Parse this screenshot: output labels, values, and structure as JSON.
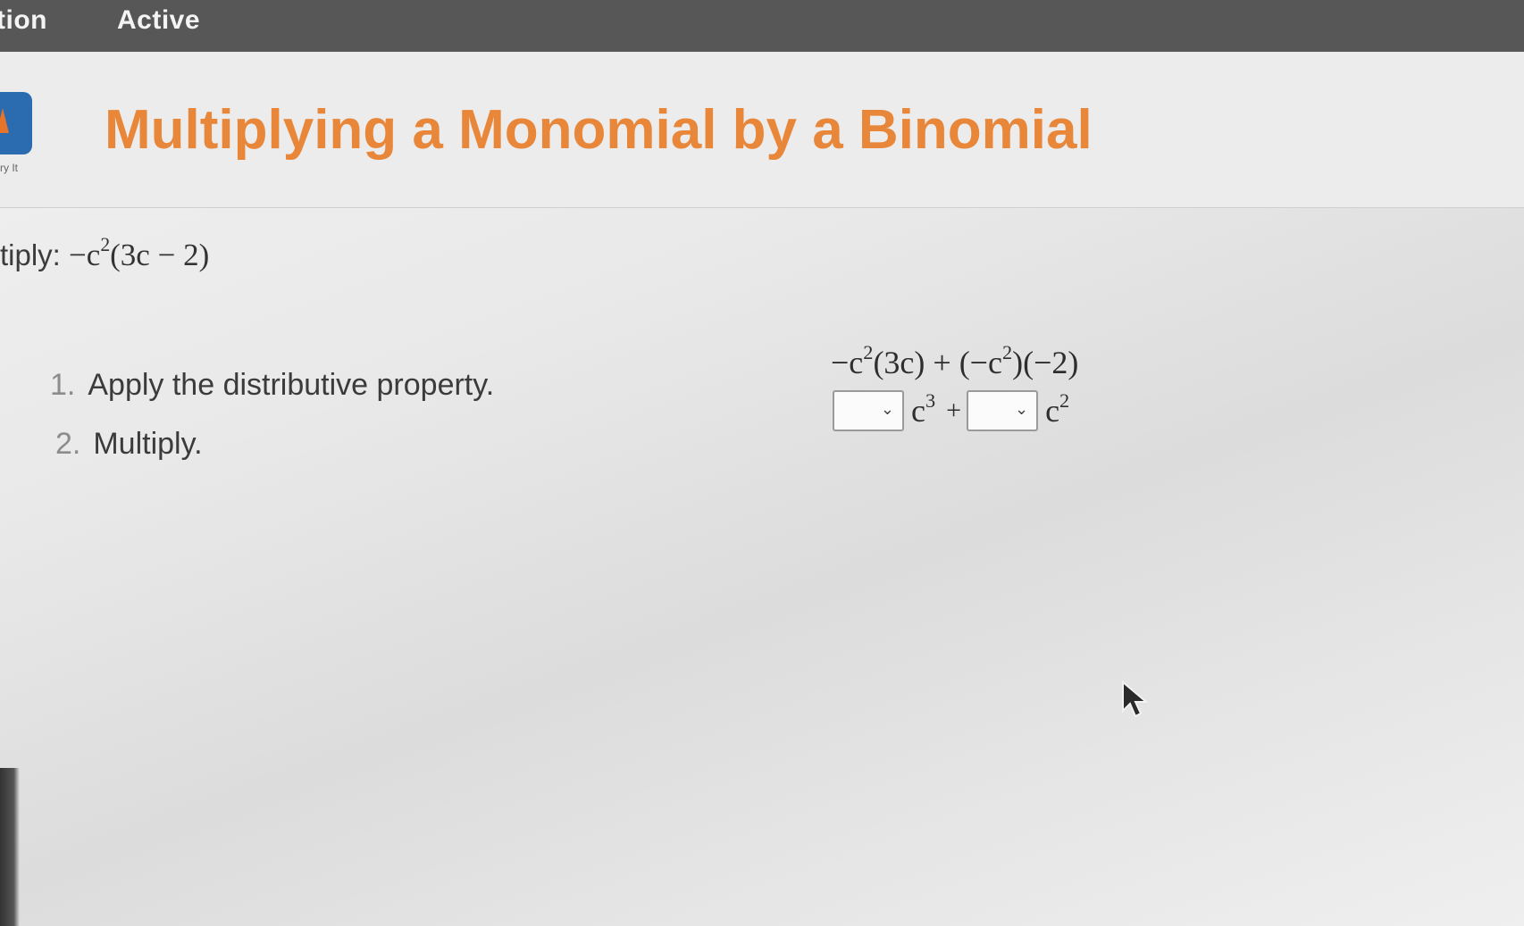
{
  "topbar": {
    "tab_left": "tion",
    "tab_active": "Active"
  },
  "header": {
    "title": "Multiplying a Monomial by a Binomial",
    "badge_caption": "ry It"
  },
  "problem": {
    "prompt_label": "tiply:",
    "expr_prefix": "−c",
    "expr_exp": "2",
    "expr_suffix": "(3c − 2)"
  },
  "steps": [
    {
      "number": "1.",
      "label": "Apply the distributive property."
    },
    {
      "number": "2.",
      "label": "Multiply."
    }
  ],
  "work": {
    "line1": {
      "part1": "−c",
      "exp1": "2",
      "part2": "(3c) + (−c",
      "exp2": "2",
      "part3": ")(−2)"
    },
    "line2": {
      "dropdown1_value": "",
      "term1_base": "c",
      "term1_exp": "3",
      "operator": "+",
      "dropdown2_value": "",
      "term2_base": "c",
      "term2_exp": "2"
    }
  },
  "icons": {
    "dropdown_chevron": "chevron-down-icon",
    "cursor": "mouse-pointer-icon"
  },
  "colors": {
    "title": "#e8873a",
    "topbar": "#575757",
    "badge": "#2b6cb0"
  }
}
